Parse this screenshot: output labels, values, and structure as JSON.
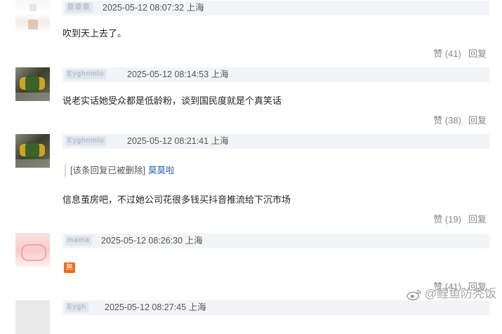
{
  "comments": [
    {
      "username": "臣臣臣",
      "time": "2025-05-12 08:07:32",
      "location": "上海",
      "text": "吹到天上去了。",
      "like_label": "赞 (41)",
      "reply_label": "回复"
    },
    {
      "username": "Eyghnmlo",
      "time": "2025-05-12 08:14:53",
      "location": "上海",
      "text": "说老实话她受众都是低龄粉，谈到国民度就是个真笑话",
      "like_label": "赞 (38)",
      "reply_label": "回复"
    },
    {
      "username": "Eyghnmlo",
      "time": "2025-05-12 08:21:41",
      "location": "上海",
      "deleted_notice": "[该条回复已被删除]",
      "deleted_user": "莫莫啦",
      "text": "信息茧房吧，不过她公司花很多钱买抖音推流给下沉市场",
      "like_label": "赞 (19)",
      "reply_label": "回复"
    },
    {
      "username": "mama",
      "time": "2025-05-12 08:26:30",
      "location": "上海",
      "emoji": "無",
      "like_label": "赞 (41)",
      "reply_label": "回复"
    },
    {
      "username": "Eygh",
      "time": "2025-05-12 08:27:45",
      "location": "上海"
    }
  ],
  "watermark": "@鲤鱼防秃饭",
  "colors": {
    "link": "#2d64b3",
    "header_bg": "#f2f4f7",
    "muted": "#888888"
  }
}
